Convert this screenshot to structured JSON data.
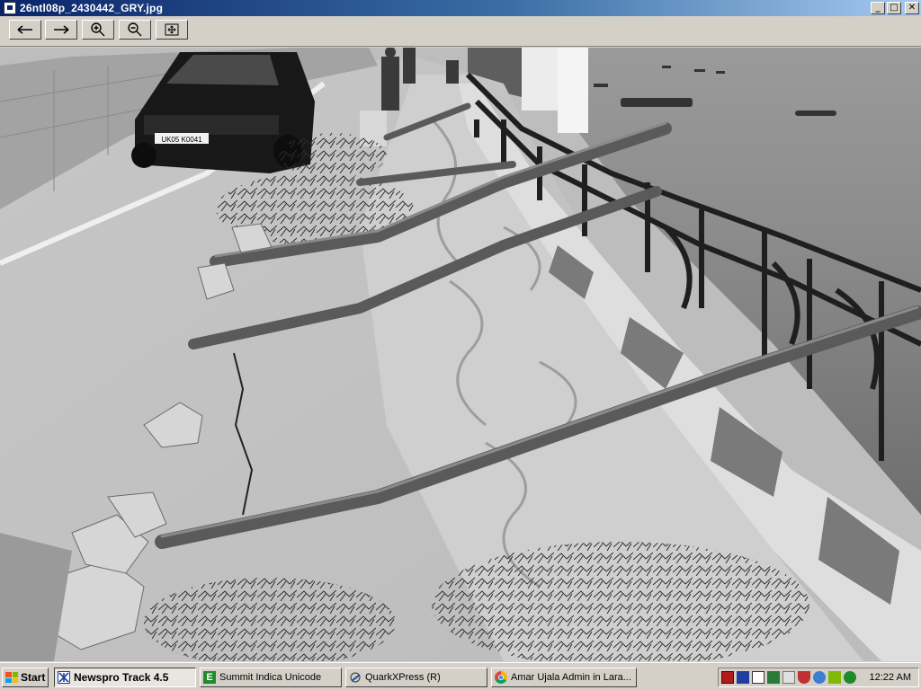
{
  "window": {
    "title": "26ntl08p_2430442_GRY.jpg",
    "buttons": {
      "minimize": "_",
      "maximize": "□",
      "close": "✕"
    }
  },
  "toolbar": {
    "buttons": [
      {
        "name": "back-button",
        "icon": "arrow-left-icon"
      },
      {
        "name": "forward-button",
        "icon": "arrow-right-icon"
      },
      {
        "name": "zoom-in-button",
        "icon": "zoom-in-icon"
      },
      {
        "name": "zoom-out-button",
        "icon": "zoom-out-icon"
      },
      {
        "name": "fit-to-window-button",
        "icon": "fit-window-icon"
      }
    ]
  },
  "photo": {
    "plate_text": "UK05 K0041",
    "grayscale": true
  },
  "taskbar": {
    "start_label": "Start",
    "tasks": [
      {
        "label": "Newspro Track 4.5",
        "icon": "newspro-icon",
        "active": true
      },
      {
        "label": "Summit Indica Unicode",
        "icon": "indica-icon",
        "active": false
      },
      {
        "label": "QuarkXPress (R)",
        "icon": "quark-icon",
        "active": false
      },
      {
        "label": "Amar Ujala Admin in Lara...",
        "icon": "chrome-icon",
        "active": false
      }
    ],
    "clock": "12:22 AM",
    "colors": {
      "indica": "#1e8b2a",
      "chrome_red": "#db4437",
      "chrome_yellow": "#f4b400",
      "chrome_green": "#0f9d58",
      "chrome_blue": "#4285f4"
    }
  }
}
